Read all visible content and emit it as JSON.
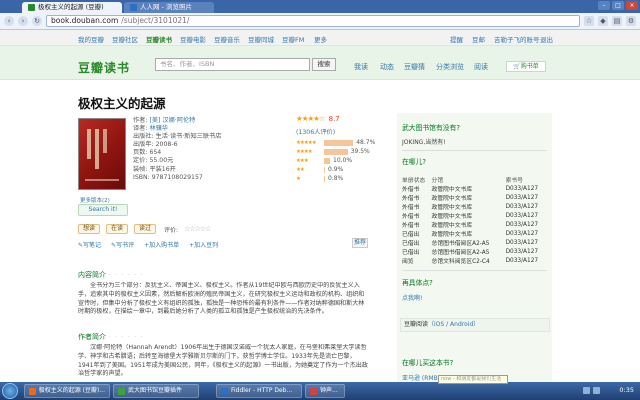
{
  "browser": {
    "tabs": [
      {
        "label": "极权主义的起源 (豆瓣)",
        "active": true,
        "color": "#2a8a2a"
      },
      {
        "label": "人人网 - 浏览照片",
        "active": false,
        "color": "#2d6fc4"
      }
    ],
    "url_host": "book.douban.com",
    "url_path": "/subject/3101021/"
  },
  "global_nav": {
    "items": [
      "我的豆瓣",
      "豆瓣社区",
      "豆瓣读书",
      "豆瓣电影",
      "豆瓣音乐",
      "豆瓣同城",
      "豆瓣FM",
      "更多"
    ],
    "current": "豆瓣读书",
    "right": [
      "提醒",
      "豆邮",
      "吉勒子飞的账号",
      "退出"
    ]
  },
  "masthead": {
    "logo": "豆瓣读书",
    "search_placeholder": "书名、作者、ISBN",
    "search_button": "搜索",
    "nav": [
      "我读",
      "动态",
      "豆瓣猜",
      "分类浏览",
      "阅读"
    ],
    "cart": "购书单"
  },
  "book": {
    "title": "极权主义的起源",
    "author_label": "作者:",
    "author": "[美] 汉娜·阿伦特",
    "translator_label": "译者:",
    "translator": "林骧华",
    "publisher_label": "出版社:",
    "publisher": "生活·读书·新知三联书店",
    "pubyear_label": "出版年:",
    "pubyear": "2008-6",
    "pages_label": "页数:",
    "pages": "654",
    "price_label": "定价:",
    "price": "55.00元",
    "binding_label": "装帧:",
    "binding": "平装16开",
    "isbn_label": "ISBN:",
    "isbn": "9787108029157",
    "more_versions": "更多版本(2)",
    "search_it": "Search it!"
  },
  "rating": {
    "stars": "★★★★☆",
    "score": "8.7",
    "votes": "(1306人评价)",
    "breakdown": [
      {
        "stars": "★★★★★",
        "pct": 48.7,
        "label": "48.7%"
      },
      {
        "stars": "★★★★",
        "pct": 39.5,
        "label": "39.5%"
      },
      {
        "stars": "★★★",
        "pct": 10.0,
        "label": "10.0%"
      },
      {
        "stars": "★★",
        "pct": 0.9,
        "label": "0.9%"
      },
      {
        "stars": "★",
        "pct": 0.8,
        "label": "0.8%"
      }
    ]
  },
  "actions": {
    "want": "想读",
    "reading": "在读",
    "read": "读过",
    "rate_label": "评价:",
    "rate_stars": "☆☆☆☆☆",
    "links": [
      "写笔记",
      "写书评",
      "加入购书单",
      "加入豆列"
    ],
    "recommend": "推荐"
  },
  "content_intro": {
    "heading": "内容简介",
    "dots": "· · · · · ·",
    "text": "全书分为三个部分：反犹主义、帝国主义、极权主义。作者从19世纪中欧与西欧历史中的反犹主义入手，追索其中的极权主义因素，然后解析欧洲的殖民帝国主义，在研究极权主义运动和政权的机构、组织和宣传时，但集中分析了极权主义有组织的孤独，孤独是一种恐怖的最有利条件——作者对纳粹德国和斯大林时期的极权，在描绘一章中，到最后她分析了人类的孤立和孤独是产生极权统治的先决条件。"
  },
  "author_intro": {
    "heading": "作者简介",
    "dots": "· · · · · ·",
    "text": "汉娜·阿伦特（Hannah Arendt）1906年出生于德国汉诺威一个犹太人家庭，在马堡和弗莱堡大学读哲学、神学和古希腊语；后转至海德堡大学雅斯贝尔斯的门下，获哲学博士学位。1933年先是流亡巴黎，1941年到了美国。1951年成为美国公民，同年，《极权主义的起源》一书出版，为她奠定了作为一个杰出政治哲学家的声望。"
  },
  "sidebar": {
    "q_heading": "武大图书馆有没有?",
    "q_answer": "JOKING,当然有!",
    "borrow_heading": "在哪儿?",
    "cols": [
      "单册状态",
      "分馆",
      "索书号"
    ],
    "rows": [
      [
        "外借书",
        "政管院中文书库",
        "D033/A127"
      ],
      [
        "外借书",
        "政管院中文书库",
        "D033/A127"
      ],
      [
        "外借书",
        "政管院中文书库",
        "D033/A127"
      ],
      [
        "外借书",
        "政管院中文书库",
        "D033/A127"
      ],
      [
        "外借书",
        "政管院中文书库",
        "D033/A127"
      ],
      [
        "已借出",
        "政管院中文书库",
        "D033/A127"
      ],
      [
        "已借出",
        "总馆图书借阅区A2-A5",
        "D033/A127"
      ],
      [
        "已借出",
        "总馆图书借阅区A2-A5",
        "D033/A127"
      ],
      [
        "阅览",
        "总馆文科阅览区C2-C4",
        "D033/A127"
      ]
    ],
    "again_heading": "再具体点?",
    "again_link": "点我啊!",
    "mobile": "豆瓣阅读",
    "mobile_tail": "（iOS / Android）",
    "buy_heading": "在哪儿买这本书?",
    "buy_item": "亚马逊 (RMB 42.00)",
    "tooltip": "now - 和朋友都是我们生活"
  },
  "taskbar": {
    "items": [
      {
        "label": "极权主义的起源 (豆瓣)...",
        "color": "#e86a1e"
      },
      {
        "label": "武大图书馆豆瓣插件",
        "color": "#3fa03f"
      },
      {
        "label": "Fiddler - HTTP Deb...",
        "color": "#2d6fc4"
      },
      {
        "label": "钟声...",
        "color": "#c44"
      }
    ],
    "clock": "0:35"
  }
}
